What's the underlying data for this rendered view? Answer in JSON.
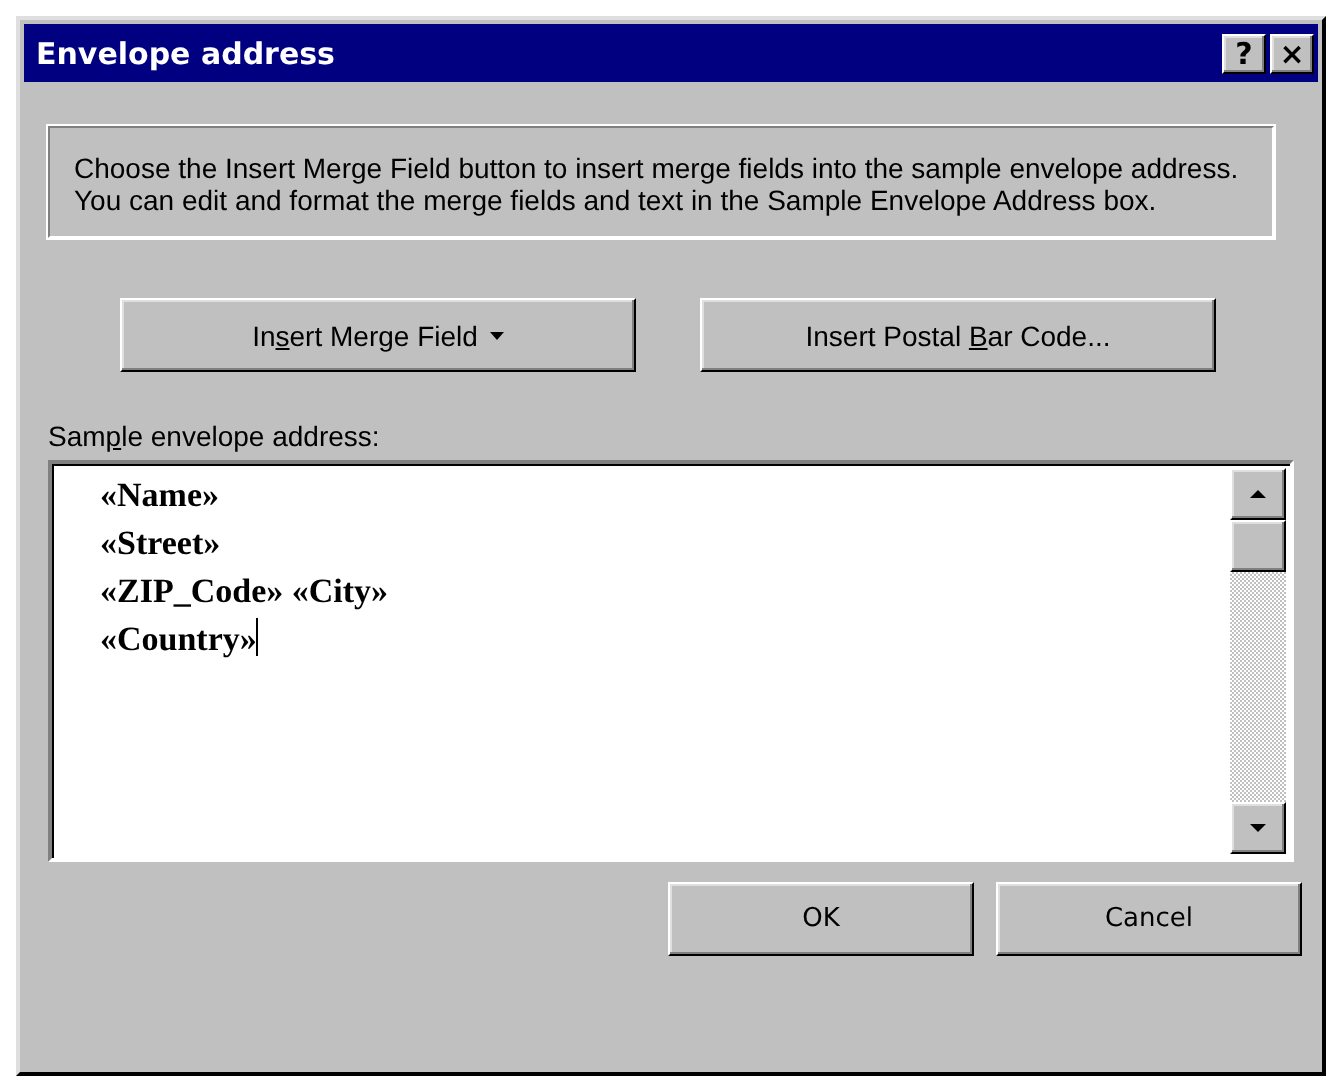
{
  "window": {
    "title": "Envelope address",
    "title_buttons": [
      "?",
      "×"
    ]
  },
  "instructions": "Choose the Insert Merge Field button to insert merge fields into the sample envelope address.  You can edit and format the merge fields and text in the Sample Envelope Address box.",
  "action_buttons": [
    {
      "label_parts": [
        "In",
        "s",
        "ert Merge Field"
      ],
      "dropdown": true
    },
    {
      "label_parts": [
        "Insert Postal ",
        "B",
        "ar Code..."
      ],
      "dropdown": false
    }
  ],
  "address_label_parts": [
    "Sam",
    "p",
    "le envelope address:"
  ],
  "address_lines": [
    "«Name»",
    "«Street»",
    "«ZIP_Code» «City»",
    "«Country»"
  ],
  "buttons": [
    "OK",
    "Cancel"
  ]
}
